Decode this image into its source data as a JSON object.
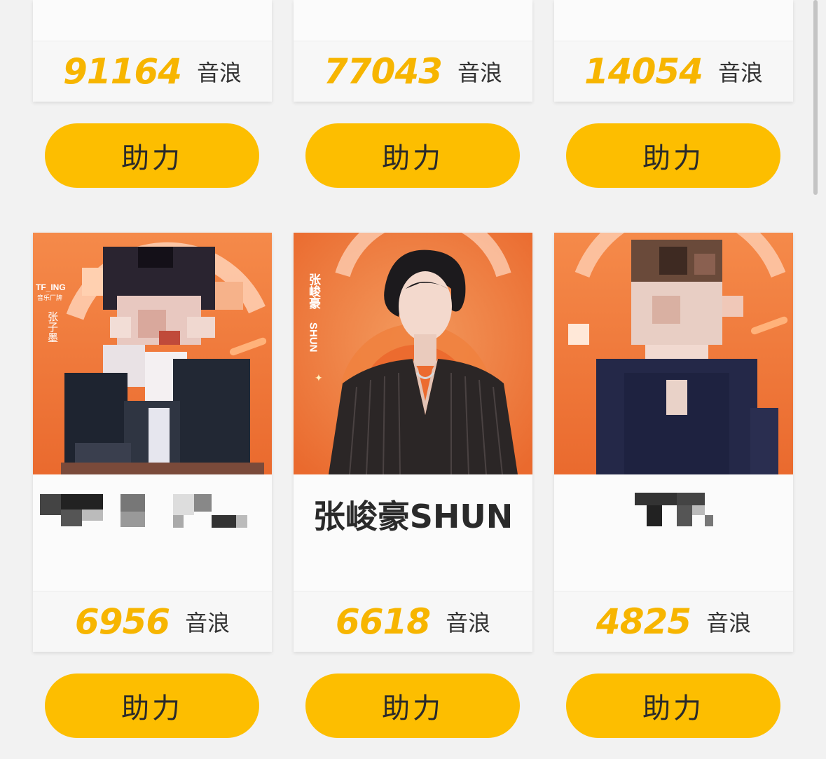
{
  "top_row": [
    {
      "score": "91164",
      "unit": "音浪",
      "button": "助力"
    },
    {
      "score": "77043",
      "unit": "音浪",
      "button": "助力"
    },
    {
      "score": "14054",
      "unit": "音浪",
      "button": "助力"
    }
  ],
  "bottom_row": [
    {
      "poster_text": "TF_ING",
      "poster_subtext": "音乐厂牌",
      "poster_name": "张子墨",
      "name": "",
      "score": "6956",
      "unit": "音浪",
      "button": "助力"
    },
    {
      "poster_name": "张峻豪",
      "poster_latin": "SHUN",
      "name": "张峻豪SHUN",
      "score": "6618",
      "unit": "音浪",
      "button": "助力"
    },
    {
      "name": "",
      "score": "4825",
      "unit": "音浪",
      "button": "助力"
    }
  ],
  "colors": {
    "accent": "#f7b500",
    "button": "#fdbe00",
    "poster_orange": "#f07a3a",
    "background": "#f2f2f2"
  }
}
